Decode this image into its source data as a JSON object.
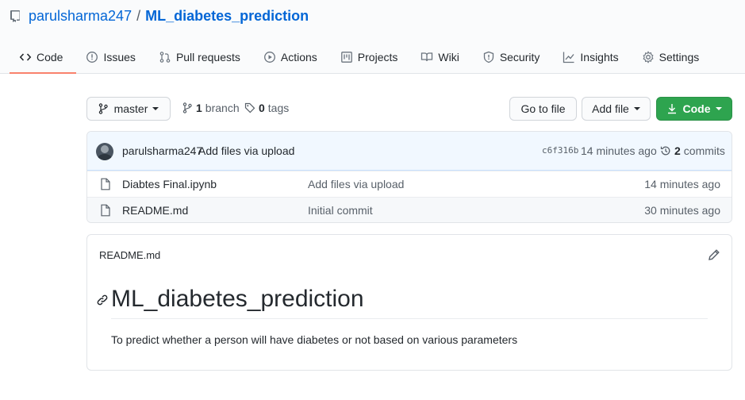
{
  "repo": {
    "owner": "parulsharma247",
    "separator": "/",
    "name": "ML_diabetes_prediction"
  },
  "tabs": [
    {
      "label": "Code",
      "icon": "code-icon",
      "active": true
    },
    {
      "label": "Issues",
      "icon": "issue-icon"
    },
    {
      "label": "Pull requests",
      "icon": "pull-request-icon"
    },
    {
      "label": "Actions",
      "icon": "play-icon"
    },
    {
      "label": "Projects",
      "icon": "project-icon"
    },
    {
      "label": "Wiki",
      "icon": "book-icon"
    },
    {
      "label": "Security",
      "icon": "shield-icon"
    },
    {
      "label": "Insights",
      "icon": "graph-icon"
    },
    {
      "label": "Settings",
      "icon": "gear-icon"
    }
  ],
  "toolbar": {
    "branch_label": "master",
    "branch_count": "1",
    "branch_word": "branch",
    "tag_count": "0",
    "tag_word": "tags",
    "go_to_file": "Go to file",
    "add_file": "Add file",
    "code_button": "Code"
  },
  "latest_commit": {
    "author": "parulsharma247",
    "message": "Add files via upload",
    "sha": "c6f316b",
    "age": "14 minutes ago",
    "commit_count": "2",
    "commit_word": "commits"
  },
  "files": [
    {
      "name": "Diabtes Final.ipynb",
      "message": "Add files via upload",
      "age": "14 minutes ago"
    },
    {
      "name": "README.md",
      "message": "Initial commit",
      "age": "30 minutes ago"
    }
  ],
  "readme": {
    "filename": "README.md",
    "heading": "ML_diabetes_prediction",
    "paragraph": "To predict whether a person will have diabetes or not based on various parameters"
  },
  "colors": {
    "accent_link": "#0366d6",
    "tab_underline": "#f9826c",
    "code_button": "#2ea44f"
  }
}
